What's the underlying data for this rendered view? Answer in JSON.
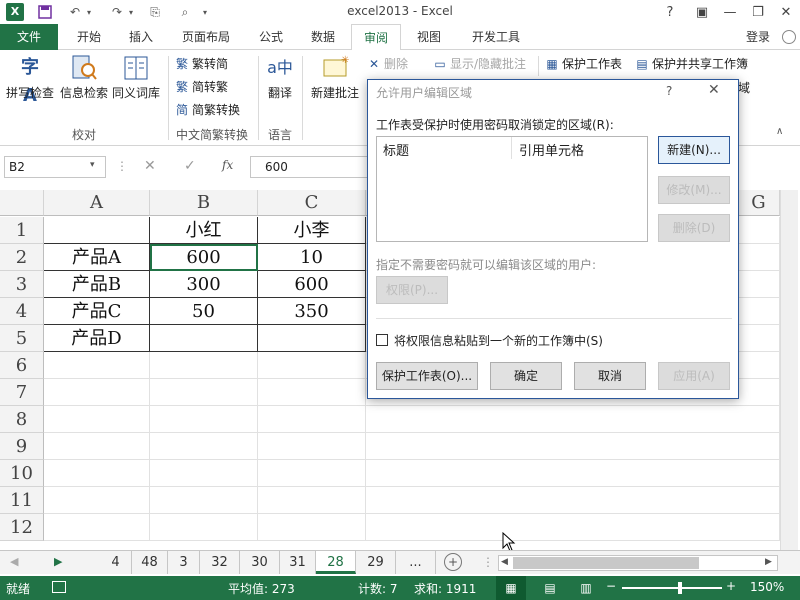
{
  "titlebar": {
    "title": "excel2013 - Excel",
    "help": "?",
    "signin": "登录"
  },
  "tabs": [
    "文件",
    "开始",
    "插入",
    "页面布局",
    "公式",
    "数据",
    "审阅",
    "视图",
    "开发工具"
  ],
  "ribbon": {
    "spellcheck": "拼写检查",
    "research": "信息检索",
    "thesaurus": "同义词库",
    "proofing_group": "校对",
    "trad_to_simp": "繁转简",
    "simp_to_trad": "简转繁",
    "conversion": "简繁转换",
    "chinese_group": "中文简繁转换",
    "translate": "翻译",
    "language_group": "语言",
    "new_comment": "新建批注",
    "delete": "删除",
    "show_hide_comment": "显示/隐藏批注",
    "protect_sheet": "保护工作表",
    "protect_share": "保护并共享工作簿",
    "partial": "域"
  },
  "formula_bar": {
    "name_box": "B2",
    "value": "600",
    "fx": "fx"
  },
  "sheet": {
    "columns": [
      "A",
      "B",
      "C",
      "G"
    ],
    "rows": [
      "1",
      "2",
      "3",
      "4",
      "5",
      "6",
      "7",
      "8",
      "9",
      "10",
      "11",
      "12"
    ],
    "header_row": [
      "",
      "小红",
      "小李"
    ],
    "data": [
      [
        "产品A",
        "600",
        "10"
      ],
      [
        "产品B",
        "300",
        "600"
      ],
      [
        "产品C",
        "50",
        "350"
      ],
      [
        "产品D",
        "",
        ""
      ]
    ]
  },
  "dialog": {
    "title": "允许用户编辑区域",
    "ranges_label": "工作表受保护时使用密码取消锁定的区域(R):",
    "col_title": "标题",
    "col_refers": "引用单元格",
    "new_btn": "新建(N)...",
    "modify_btn": "修改(M)...",
    "delete_btn": "删除(D)",
    "users_label": "指定不需要密码就可以编辑该区域的用户:",
    "permissions_btn": "权限(P)...",
    "paste_checkbox_label": "将权限信息粘贴到一个新的工作簿中(S)",
    "protect_btn": "保护工作表(O)...",
    "ok_btn": "确定",
    "cancel_btn": "取消",
    "apply_btn": "应用(A)"
  },
  "sheet_tabs": [
    "4",
    "48",
    "3",
    "32",
    "30",
    "31",
    "28",
    "29",
    "..."
  ],
  "active_sheet": "28",
  "status": {
    "ready": "就绪",
    "average": "平均值: 273",
    "count": "计数: 7",
    "sum": "求和: 1911",
    "zoom": "150%"
  },
  "colors": {
    "accent": "#217346",
    "dialog_border": "#2b579a"
  }
}
